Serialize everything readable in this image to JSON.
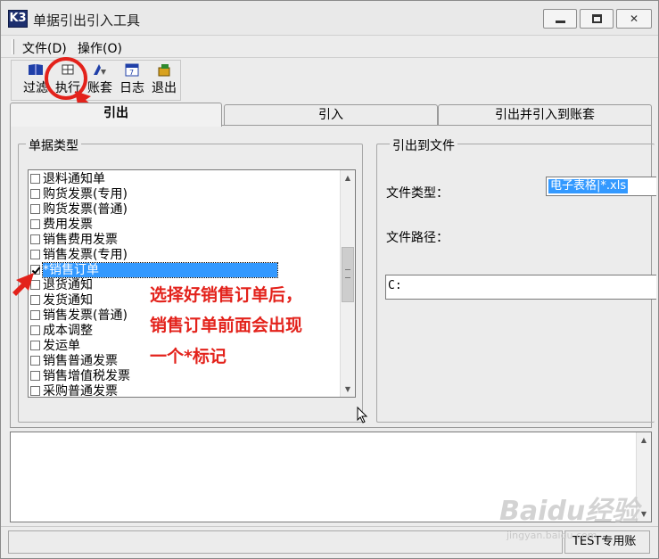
{
  "window": {
    "title": "单据引出引入工具"
  },
  "menu": {
    "file": "文件(D)",
    "ops": "操作(O)"
  },
  "toolbar": {
    "filter": "过滤",
    "exec": "执行",
    "book": "账套",
    "log": "日志",
    "quit": "退出"
  },
  "tabs": [
    "引出",
    "引入",
    "引出并引入到账套"
  ],
  "left_group": {
    "title": "单据类型",
    "items": [
      {
        "label": "退料通知单",
        "checked": false,
        "selected": false
      },
      {
        "label": "购货发票(专用)",
        "checked": false,
        "selected": false
      },
      {
        "label": "购货发票(普通)",
        "checked": false,
        "selected": false
      },
      {
        "label": "费用发票",
        "checked": false,
        "selected": false
      },
      {
        "label": "销售费用发票",
        "checked": false,
        "selected": false
      },
      {
        "label": "销售发票(专用)",
        "checked": false,
        "selected": false
      },
      {
        "label": "*销售订单",
        "checked": true,
        "selected": true
      },
      {
        "label": "退货通知",
        "checked": false,
        "selected": false
      },
      {
        "label": "发货通知",
        "checked": false,
        "selected": false
      },
      {
        "label": "销售发票(普通)",
        "checked": false,
        "selected": false
      },
      {
        "label": "成本调整",
        "checked": false,
        "selected": false
      },
      {
        "label": "发运单",
        "checked": false,
        "selected": false
      },
      {
        "label": "销售普通发票",
        "checked": false,
        "selected": false
      },
      {
        "label": "销售增值税发票",
        "checked": false,
        "selected": false
      },
      {
        "label": "采购普通发票",
        "checked": false,
        "selected": false
      }
    ]
  },
  "right_group": {
    "title": "引出到文件",
    "file_type_label": "文件类型：",
    "file_type_value": "电子表格|*.xls",
    "file_path_label": "文件路径：",
    "file_path_value": "C:"
  },
  "status": {
    "right": "TEST专用账"
  },
  "annotation": {
    "line1": "选择好销售订单后，",
    "line2": "销售订单前面会出现",
    "line3": "一个*标记"
  },
  "watermark": {
    "logo": "Baidu经验",
    "url": "jingyan.baidu.com"
  },
  "colors": {
    "highlight": "#3399ff",
    "annotation": "#e3221b"
  }
}
